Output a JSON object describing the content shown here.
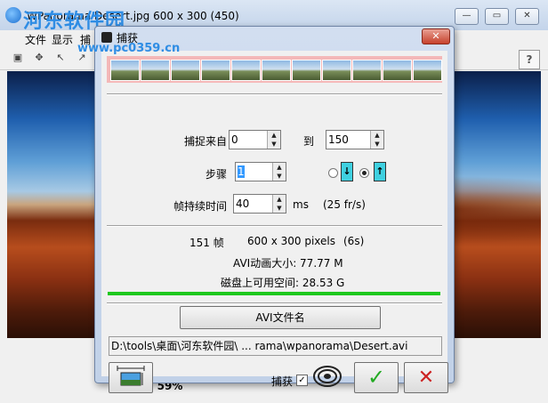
{
  "main_window": {
    "title": "WPanorama  Desert.jpg     600 x 300 (450)",
    "watermark_text": "河东软件园",
    "watermark_url": "www.pc0359.cn",
    "menu": [
      "文件",
      "显示",
      "捕"
    ],
    "zoom_text": "Zoom: 59%",
    "help_label": "?"
  },
  "dialog": {
    "title": "捕获",
    "close_label": "✕",
    "capture_from_label": "捕捉来自",
    "capture_from_value": "0",
    "to_label": "到",
    "capture_to_value": "150",
    "step_label": "步骤",
    "step_value": "1",
    "frame_duration_label": "帧持续时间",
    "frame_duration_value": "40",
    "ms_label": "ms",
    "fps_text": "(25 fr/s)",
    "frames_text": "151 帧",
    "pixels_text": "600 x 300 pixels",
    "seconds_text": "(6s)",
    "avi_size_text": "AVI动画大小:  77.77 M",
    "disk_space_text": "磁盘上可用空间:   28.53 G",
    "progress_fraction": 1.0,
    "avi_filename_button": "AVI文件名",
    "file_path": "D:\\tools\\桌面\\河东软件园\\ ... rama\\wpanorama\\Desert.avi",
    "capture_checkbox_label": "捕获",
    "capture_checked_mark": "✓",
    "ok_label": "✓",
    "cancel_label": "✕",
    "direction_selected": "up"
  },
  "colors": {
    "film_strip": "#f4b8b8",
    "progress": "#1ec81e",
    "ok_check": "#22aa22",
    "cancel_x": "#cc2222"
  }
}
